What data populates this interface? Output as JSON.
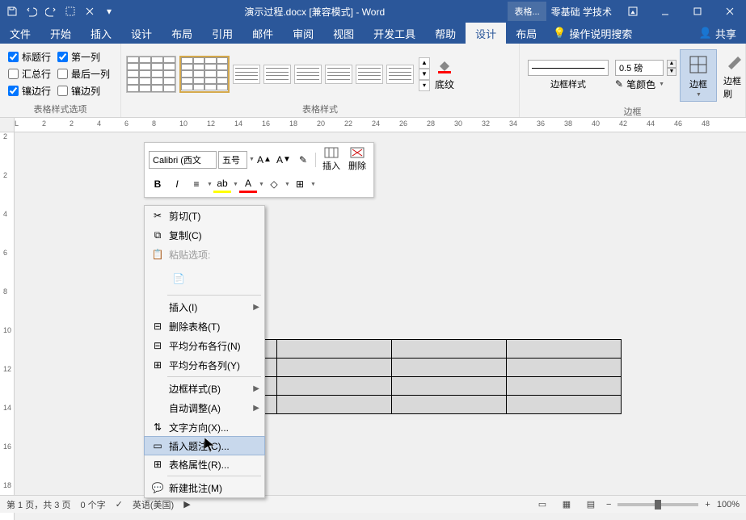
{
  "app": {
    "document_title": "演示过程.docx [兼容模式] - Word",
    "tool_tab": "表格...",
    "user": "零基础 学技术"
  },
  "tabs": {
    "file": "文件",
    "home": "开始",
    "insert": "插入",
    "design": "设计",
    "layout": "布局",
    "references": "引用",
    "mailings": "邮件",
    "review": "审阅",
    "view": "视图",
    "developer": "开发工具",
    "help": "帮助",
    "tbl_design": "设计",
    "tbl_layout": "布局",
    "tell_me": "操作说明搜索",
    "share": "共享"
  },
  "ribbon": {
    "options": {
      "header_row": "标题行",
      "first_col": "第一列",
      "total_row": "汇总行",
      "last_col": "最后一列",
      "banded_rows": "镶边行",
      "banded_cols": "镶边列",
      "group_label": "表格样式选项"
    },
    "styles": {
      "group_label": "表格样式"
    },
    "shading": {
      "label": "底纹"
    },
    "borders": {
      "style_label": "边框样式",
      "weight": "0.5 磅",
      "pen_color": "笔颜色",
      "border_btn": "边框",
      "painter": "边框刷",
      "group_label": "边框"
    }
  },
  "ruler": {
    "marks": [
      "L",
      "2",
      "2",
      "4",
      "6",
      "8",
      "10",
      "12",
      "14",
      "16",
      "18",
      "20",
      "22",
      "24",
      "26",
      "28",
      "30",
      "32",
      "34",
      "36",
      "38",
      "40",
      "42",
      "44",
      "46",
      "48"
    ],
    "v_marks": [
      "2",
      "2",
      "4",
      "6",
      "8",
      "10",
      "12",
      "14",
      "16",
      "18"
    ]
  },
  "mini": {
    "font": "Calibri (西文",
    "size": "五号",
    "insert": "插入",
    "delete": "删除"
  },
  "ctx": {
    "cut": "剪切(T)",
    "copy": "复制(C)",
    "paste_label": "粘贴选项:",
    "insert": "插入(I)",
    "delete_table": "删除表格(T)",
    "dist_rows": "平均分布各行(N)",
    "dist_cols": "平均分布各列(Y)",
    "border_style": "边框样式(B)",
    "autofit": "自动调整(A)",
    "text_dir": "文字方向(X)...",
    "caption": "插入题注(C)...",
    "props": "表格属性(R)...",
    "comment": "新建批注(M)"
  },
  "status": {
    "page": "第 1 页，共 3 页",
    "words": "0 个字",
    "lang": "英语(美国)",
    "zoom": "100%"
  }
}
